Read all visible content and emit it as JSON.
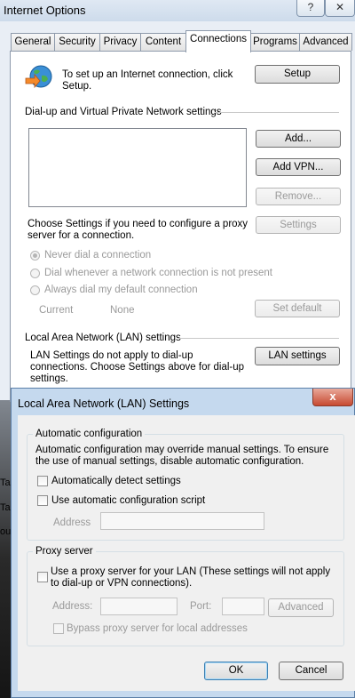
{
  "internet_options": {
    "title": "Internet Options",
    "help_glyph": "?",
    "close_glyph": "✕",
    "tabs": [
      "General",
      "Security",
      "Privacy",
      "Content",
      "Connections",
      "Programs",
      "Advanced"
    ],
    "active_tab": "Connections",
    "setup_text": "To set up an Internet connection, click Setup.",
    "setup_button": "Setup",
    "dialup_header": "Dial-up and Virtual Private Network settings",
    "add_button": "Add...",
    "add_vpn_button": "Add VPN...",
    "remove_button": "Remove...",
    "proxy_text": "Choose Settings if you need to configure a proxy server for a connection.",
    "settings_button": "Settings",
    "radio_never": "Never dial a connection",
    "radio_whenever": "Dial whenever a network connection is not present",
    "radio_always": "Always dial my default connection",
    "current_label": "Current",
    "current_value": "None",
    "set_default_button": "Set default",
    "lan_header": "Local Area Network (LAN) settings",
    "lan_text": "LAN Settings do not apply to dial-up connections. Choose Settings above for dial-up settings.",
    "lan_settings_button": "LAN settings"
  },
  "background": {
    "fragments": [
      "Ta",
      "Ta",
      "out"
    ]
  },
  "lan_dialog": {
    "title": "Local Area Network (LAN) Settings",
    "close_glyph": "x",
    "auto_group": "Automatic configuration",
    "auto_text": "Automatic configuration may override manual settings.  To ensure the use of manual settings, disable automatic configuration.",
    "auto_detect_label": "Automatically detect settings",
    "auto_detect_checked": false,
    "use_script_label": "Use automatic configuration script",
    "use_script_checked": false,
    "address_label": "Address",
    "address_value": "",
    "proxy_group": "Proxy server",
    "use_proxy_label": "Use a proxy server for your LAN (These settings will not apply to dial-up or VPN connections).",
    "use_proxy_checked": false,
    "proxy_address_label": "Address:",
    "proxy_address_value": "",
    "port_label": "Port:",
    "port_value": "",
    "advanced_button": "Advanced",
    "bypass_label": "Bypass proxy server for local addresses",
    "bypass_checked": false,
    "ok_button": "OK",
    "cancel_button": "Cancel"
  },
  "colors": {
    "dialog_frame": "#c5d9ee",
    "close_button": "#c74a31",
    "default_button_border": "#3c7fb1"
  }
}
